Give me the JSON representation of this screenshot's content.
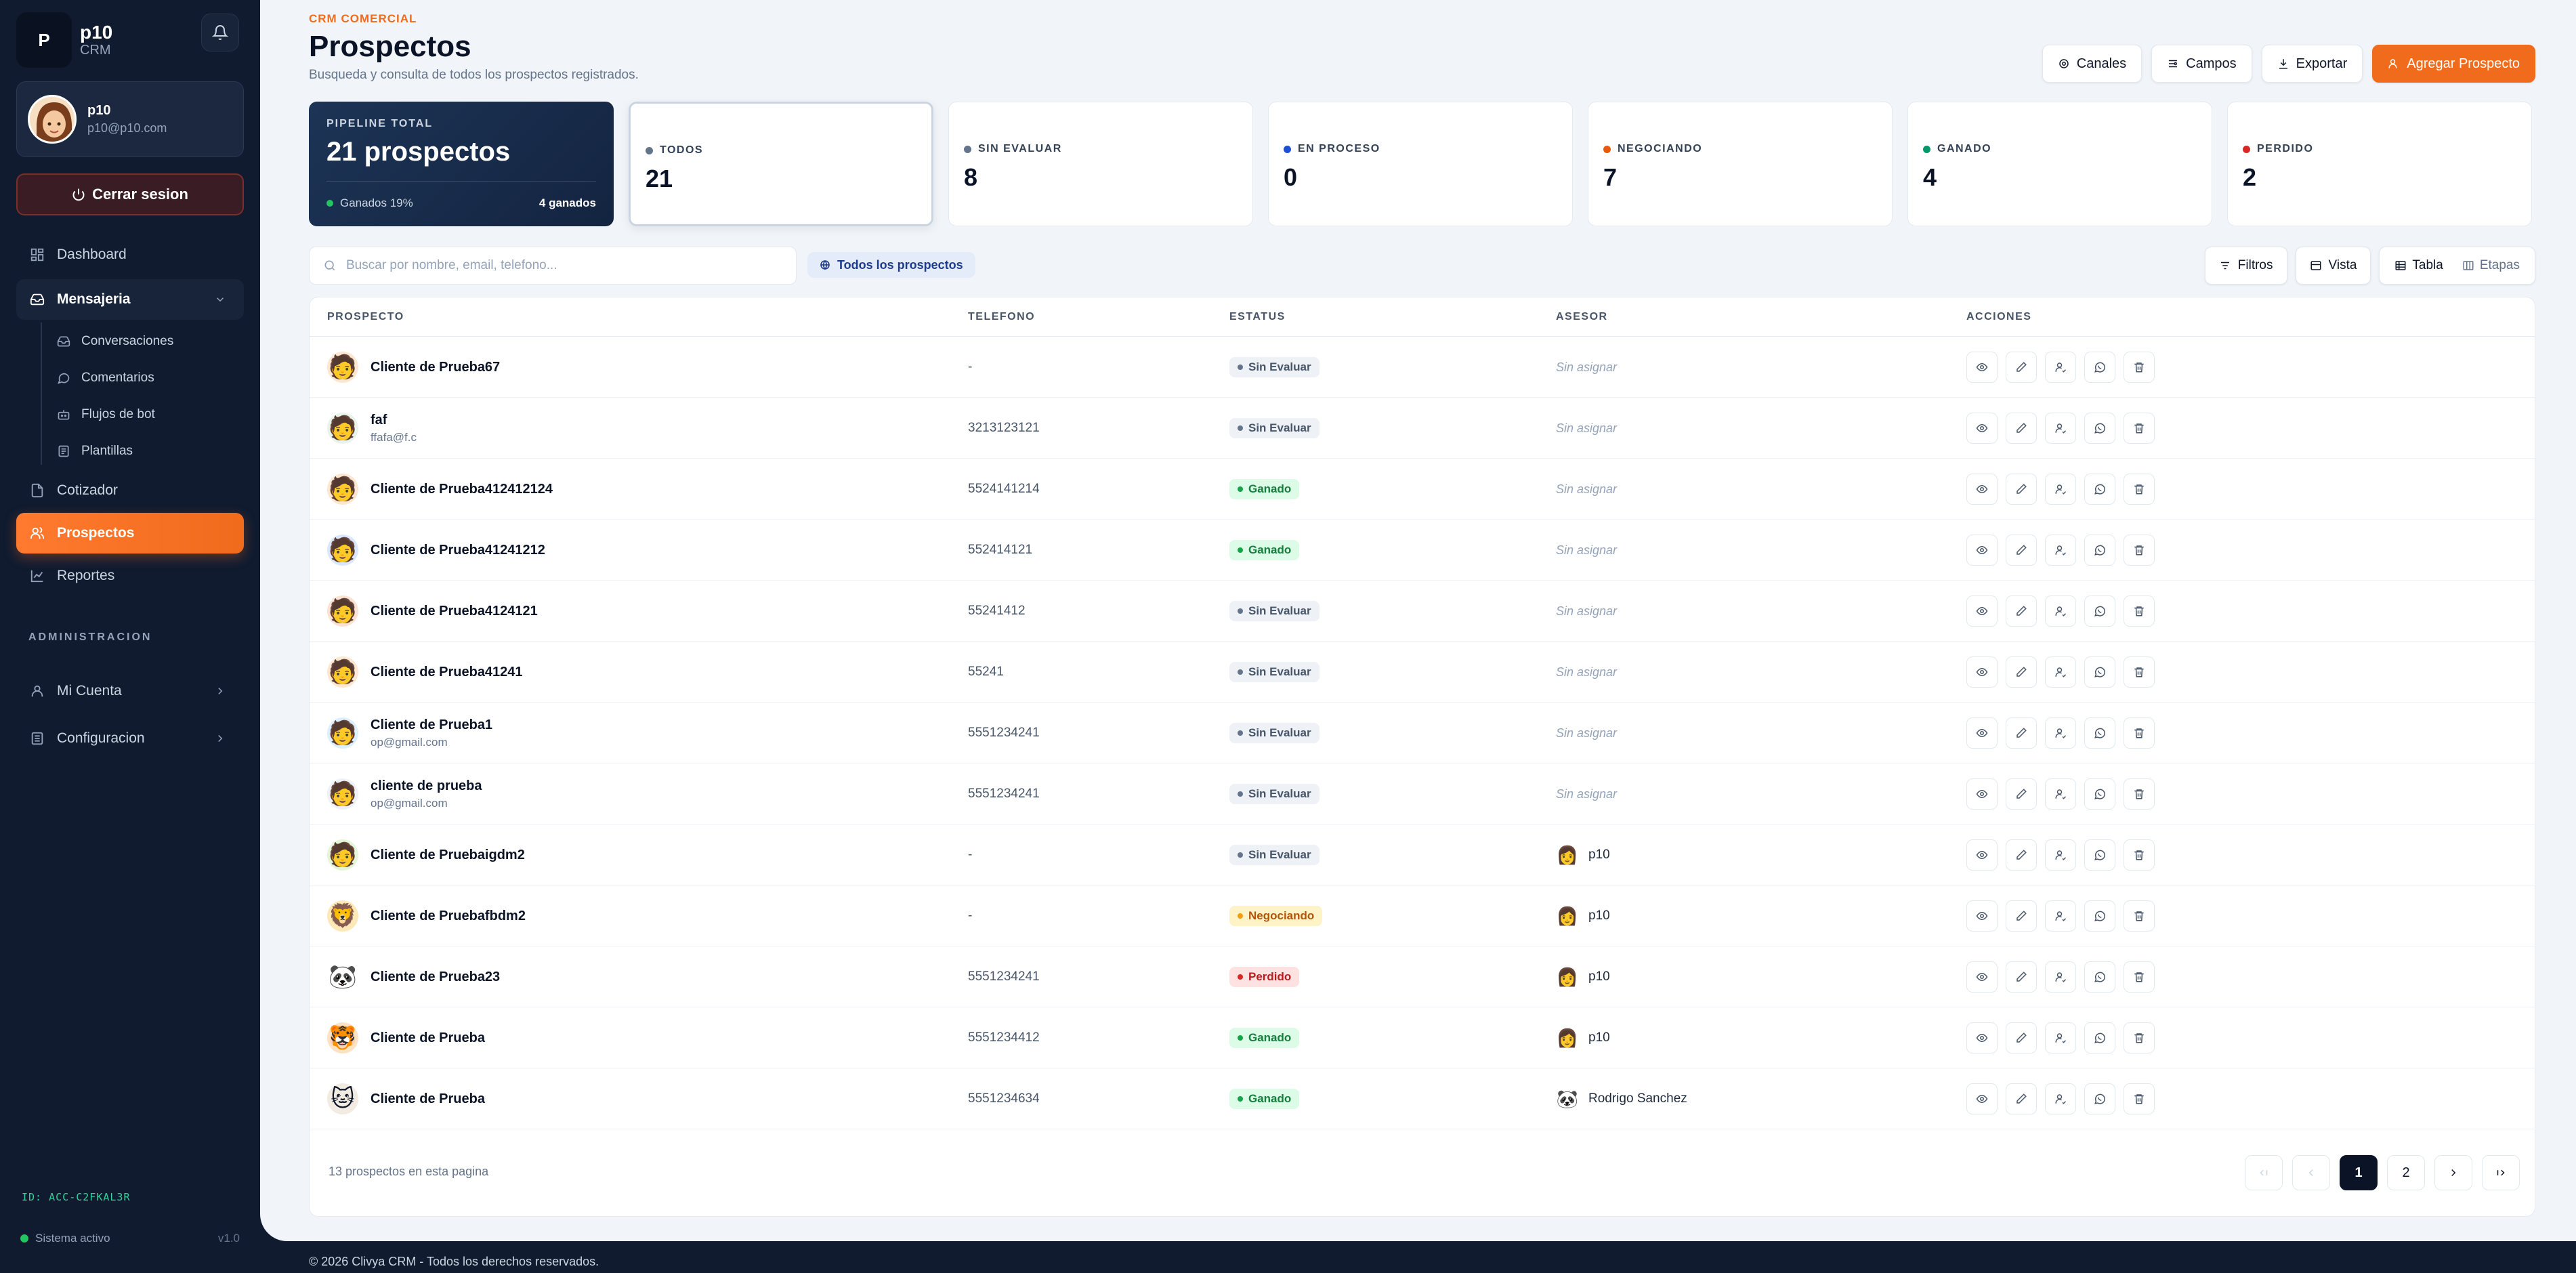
{
  "brand": {
    "logo_letter": "P",
    "name": "p10",
    "sub": "CRM"
  },
  "user": {
    "name": "p10",
    "email": "p10@p10.com"
  },
  "sidebar": {
    "logout": "Cerrar sesion",
    "items": [
      {
        "label": "Dashboard",
        "icon": "dashboard-icon"
      },
      {
        "label": "Mensajeria",
        "icon": "inbox-icon"
      },
      {
        "label": "Cotizador",
        "icon": "quote-icon"
      },
      {
        "label": "Prospectos",
        "icon": "users-icon"
      },
      {
        "label": "Reportes",
        "icon": "chart-icon"
      }
    ],
    "sub_items": [
      {
        "label": "Conversaciones",
        "icon": "inbox-icon"
      },
      {
        "label": "Comentarios",
        "icon": "comment-icon"
      },
      {
        "label": "Flujos de bot",
        "icon": "bot-icon"
      },
      {
        "label": "Plantillas",
        "icon": "template-icon"
      }
    ],
    "admin_label": "ADMINISTRACION",
    "admin_items": [
      {
        "label": "Mi Cuenta",
        "icon": "user-icon"
      },
      {
        "label": "Configuracion",
        "icon": "settings-icon"
      }
    ],
    "account_id": "ID: ACC-C2FKAL3R",
    "system_status": "Sistema activo",
    "version": "v1.0"
  },
  "header": {
    "eyebrow": "CRM COMERCIAL",
    "title": "Prospectos",
    "subtitle": "Busqueda y consulta de todos los prospectos registrados.",
    "actions": {
      "channels": "Canales",
      "fields": "Campos",
      "export": "Exportar",
      "add": "Agregar Prospecto"
    }
  },
  "pipeline": {
    "label": "PIPELINE TOTAL",
    "value": "21 prospectos",
    "won_pct": "Ganados 19%",
    "won_count": "4 ganados"
  },
  "stats": [
    {
      "label": "TODOS",
      "value": "21",
      "color": "#64748b"
    },
    {
      "label": "SIN EVALUAR",
      "value": "8",
      "color": "#64748b"
    },
    {
      "label": "EN PROCESO",
      "value": "0",
      "color": "#1d4ed8"
    },
    {
      "label": "NEGOCIANDO",
      "value": "7",
      "color": "#ea580c"
    },
    {
      "label": "GANADO",
      "value": "4",
      "color": "#059669"
    },
    {
      "label": "PERDIDO",
      "value": "2",
      "color": "#dc2626"
    }
  ],
  "search": {
    "placeholder": "Buscar por nombre, email, telefono...",
    "value": ""
  },
  "filter_chip": "Todos los prospectos",
  "controls": {
    "filters": "Filtros",
    "view": "Vista",
    "table": "Tabla",
    "stages": "Etapas"
  },
  "table": {
    "columns": {
      "prospect": "PROSPECTO",
      "phone": "TELEFONO",
      "status": "ESTATUS",
      "advisor": "ASESOR",
      "actions": "ACCIONES"
    },
    "unassigned": "Sin asignar",
    "rows": [
      {
        "name": "Cliente de Prueba67",
        "email": "",
        "avatar": "🧑",
        "phone": "-",
        "status": "Sin Evaluar",
        "advisor": ""
      },
      {
        "name": "faf",
        "email": "ffafa@f.c",
        "avatar": "🧑",
        "phone": "3213123121",
        "status": "Sin Evaluar",
        "advisor": ""
      },
      {
        "name": "Cliente de Prueba412412124",
        "email": "",
        "avatar": "🧑",
        "phone": "5524141214",
        "status": "Ganado",
        "advisor": ""
      },
      {
        "name": "Cliente de Prueba41241212",
        "email": "",
        "avatar": "🧑",
        "phone": "552414121",
        "status": "Ganado",
        "advisor": ""
      },
      {
        "name": "Cliente de Prueba4124121",
        "email": "",
        "avatar": "🧑",
        "phone": "55241412",
        "status": "Sin Evaluar",
        "advisor": ""
      },
      {
        "name": "Cliente de Prueba41241",
        "email": "",
        "avatar": "🧑",
        "phone": "55241",
        "status": "Sin Evaluar",
        "advisor": ""
      },
      {
        "name": "Cliente de Prueba1",
        "email": "op@gmail.com",
        "avatar": "🧑",
        "phone": "5551234241",
        "status": "Sin Evaluar",
        "advisor": ""
      },
      {
        "name": "cliente de prueba",
        "email": "op@gmail.com",
        "avatar": "🧑",
        "phone": "5551234241",
        "status": "Sin Evaluar",
        "advisor": ""
      },
      {
        "name": "Cliente de Pruebaigdm2",
        "email": "",
        "avatar": "🧑",
        "phone": "-",
        "status": "Sin Evaluar",
        "advisor": "p10"
      },
      {
        "name": "Cliente de Pruebafbdm2",
        "email": "",
        "avatar": "🦁",
        "phone": "-",
        "status": "Negociando",
        "advisor": "p10"
      },
      {
        "name": "Cliente de Prueba23",
        "email": "",
        "avatar": "🐼",
        "phone": "5551234241",
        "status": "Perdido",
        "advisor": "p10"
      },
      {
        "name": "Cliente de Prueba",
        "email": "",
        "avatar": "🐯",
        "phone": "5551234412",
        "status": "Ganado",
        "advisor": "p10"
      },
      {
        "name": "Cliente de Prueba",
        "email": "",
        "avatar": "🐱",
        "phone": "5551234634",
        "status": "Ganado",
        "advisor": "Rodrigo Sanchez"
      }
    ],
    "footer": "13 prospectos en esta pagina"
  },
  "pagination": {
    "pages": [
      "1",
      "2"
    ],
    "current": "1"
  },
  "footer": "© 2026 Clivya CRM - Todos los derechos reservados."
}
